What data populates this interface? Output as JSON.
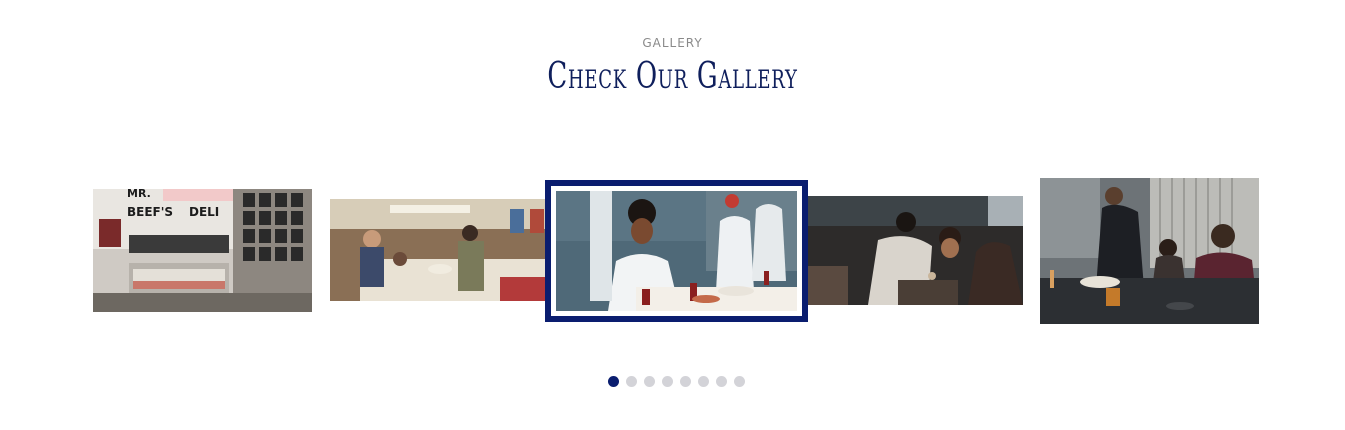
{
  "gallery": {
    "eyebrow": "GALLERY",
    "title": "Check Our Gallery",
    "images": [
      {
        "subject": "deli storefront with photo wall and display case",
        "sign": "MR. BEEF'S DELI"
      },
      {
        "subject": "family dinner at a long table"
      },
      {
        "subject": "chef in white jacket plating in a kitchen",
        "active": true
      },
      {
        "subject": "diners at a restaurant table"
      },
      {
        "subject": "waiter serving a fine-dining table"
      }
    ],
    "pagination": {
      "count": 8,
      "active_index": 0
    }
  },
  "colors": {
    "accent": "#0a1d6f",
    "title": "#0f1f5c",
    "dot_inactive": "#d3d3d8",
    "eyebrow": "#8a8a8a"
  }
}
